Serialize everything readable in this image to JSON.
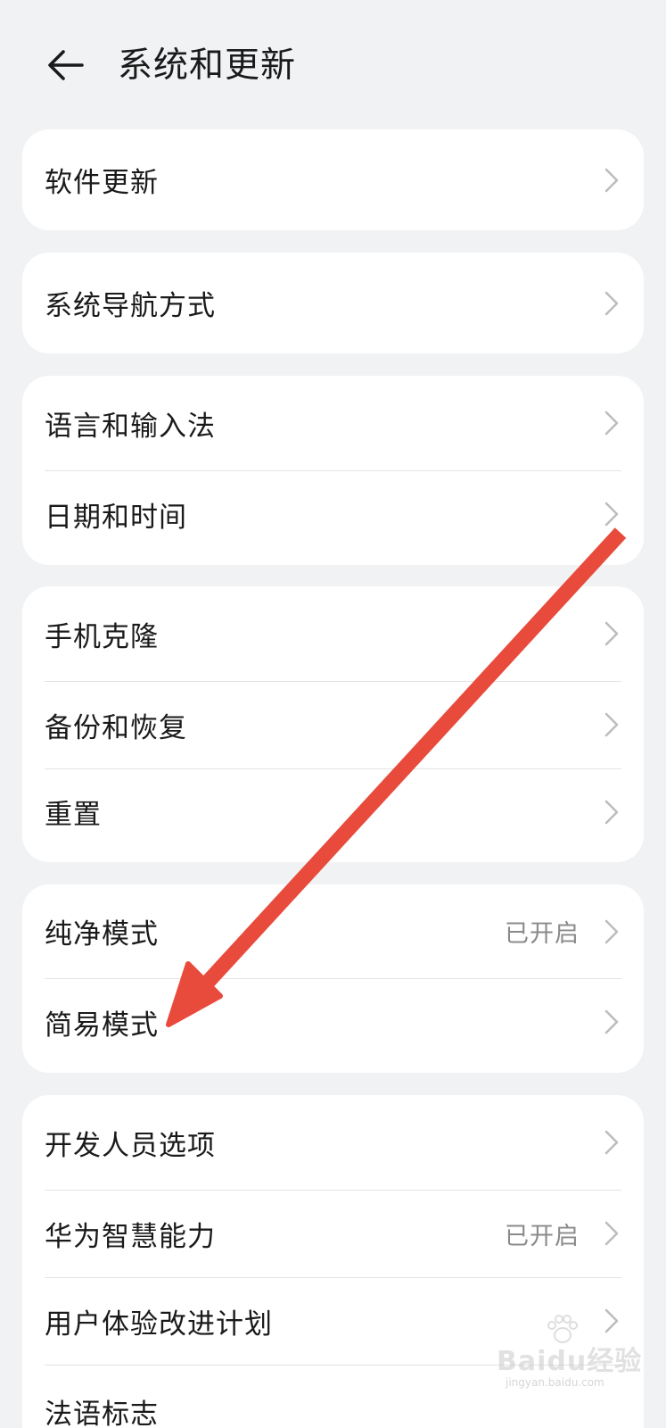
{
  "header": {
    "title": "系统和更新",
    "back_icon": "arrow-left-icon"
  },
  "groups": [
    {
      "items": [
        {
          "label": "软件更新"
        }
      ]
    },
    {
      "items": [
        {
          "label": "系统导航方式"
        }
      ]
    },
    {
      "items": [
        {
          "label": "语言和输入法"
        },
        {
          "label": "日期和时间"
        }
      ]
    },
    {
      "items": [
        {
          "label": "手机克隆"
        },
        {
          "label": "备份和恢复"
        },
        {
          "label": "重置"
        }
      ]
    },
    {
      "items": [
        {
          "label": "纯净模式",
          "value": "已开启"
        },
        {
          "label": "简易模式"
        }
      ]
    },
    {
      "items": [
        {
          "label": "开发人员选项"
        },
        {
          "label": "华为智慧能力",
          "value": "已开启"
        },
        {
          "label": "用户体验改进计划"
        },
        {
          "label": "法语标志"
        }
      ]
    }
  ],
  "annotation": {
    "color": "#e84a3b",
    "icon": "red-arrow-annotation"
  },
  "watermark": {
    "text": "Baidu经验",
    "sub": "jingyan.baidu.com"
  }
}
